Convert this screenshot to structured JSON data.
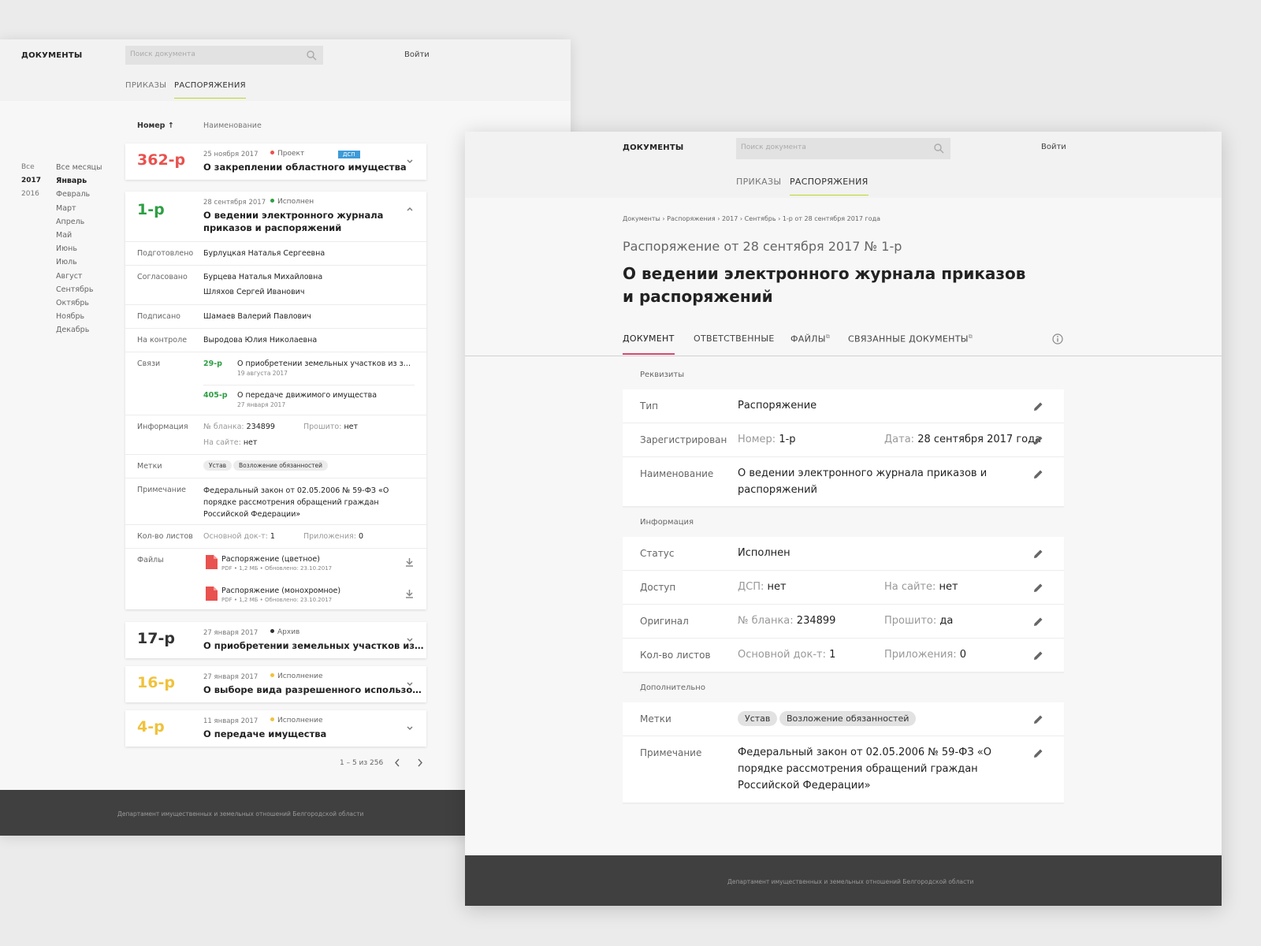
{
  "common": {
    "logo": "ДОКУМЕНТЫ",
    "search_placeholder": "Поиск документа",
    "login": "Войти",
    "nav": [
      "ПРИКАЗЫ",
      "РАСПОРЯЖЕНИЯ"
    ],
    "footer": "Департамент имущественных и земельных отношений Белгородской области"
  },
  "list": {
    "years": [
      "Все",
      "2017",
      "2016"
    ],
    "months": [
      "Все месяцы",
      "Январь",
      "Февраль",
      "Март",
      "Апрель",
      "Май",
      "Июнь",
      "Июль",
      "Август",
      "Сентябрь",
      "Октябрь",
      "Ноябрь",
      "Декабрь"
    ],
    "col_number": "Номер",
    "col_name": "Наименование",
    "card1": {
      "num": "362-р",
      "date": "25 ноября 2017",
      "status": "Проект",
      "badge": "ДСП",
      "title": "О закреплении областного имущества"
    },
    "card2": {
      "num": "1-р",
      "date": "28 сентября 2017",
      "status": "Исполнен",
      "title": "О ведении электронного журнала приказов и распоряжений",
      "labels": {
        "prepared": "Подготовлено",
        "agreed": "Согласовано",
        "signed": "Подписано",
        "control": "На контроле",
        "links": "Связи",
        "info": "Информация",
        "tags": "Метки",
        "note": "Примечание",
        "sheets": "Кол-во листов",
        "files": "Файлы"
      },
      "prepared": "Бурлуцкая Наталья Сергеевна",
      "agreed1": "Бурцева Наталья Михайловна",
      "agreed2": "Шляхов Сергей Иванович",
      "signed": "Шамаев Валерий Павлович",
      "control": "Выродова Юлия Николаевна",
      "link1": {
        "num": "29-р",
        "title": "О приобретении земельных участков из з…",
        "date": "19 августа 2017"
      },
      "link2": {
        "num": "405-р",
        "title": "О передаче движимого имущества",
        "date": "27 января 2017"
      },
      "info_blank_label": "№ бланка:",
      "info_blank": "234899",
      "info_stitched_label": "Прошито:",
      "info_stitched": "нет",
      "info_site_label": "На сайте:",
      "info_site": "нет",
      "tag1": "Устав",
      "tag2": "Возложение обязанностей",
      "note": "Федеральный закон от 02.05.2006 № 59-ФЗ «О порядке рассмотрения обращений граждан Российской Федерации»",
      "sheets_main_label": "Основной док-т:",
      "sheets_main": "1",
      "sheets_app_label": "Приложения:",
      "sheets_app": "0",
      "file1": {
        "name": "Распоряжение (цветное)",
        "meta": "PDF • 1,2 МБ • Обновлено: 23.10.2017"
      },
      "file2": {
        "name": "Распоряжение (монохромное)",
        "meta": "PDF • 1,2 МБ • Обновлено: 23.10.2017"
      }
    },
    "card3": {
      "num": "17-р",
      "date": "27 января 2017",
      "status": "Архив",
      "title": "О приобретении земельных участков из…"
    },
    "card4": {
      "num": "16-р",
      "date": "27 января 2017",
      "status": "Исполнение",
      "title": "О выборе вида разрешенного использо…"
    },
    "card5": {
      "num": "4-р",
      "date": "11 января 2017",
      "status": "Исполнение",
      "title": "О передаче имущества"
    },
    "pager": "1 – 5 из 256"
  },
  "detail": {
    "breadcrumb": "Документы › Распоряжения › 2017 › Сентябрь › 1-р от 28 сентября 2017 года",
    "subtitle": "Распоряжение от 28 сентября 2017 № 1-р",
    "title": "О ведении электронного журнала приказов и распоряжений",
    "tabs": [
      "ДОКУМЕНТ",
      "ОТВЕТСТВЕННЫЕ",
      "ФАЙЛЫ",
      "СВЯЗАННЫЕ ДОКУМЕНТЫ"
    ],
    "sec_requisites": "Реквизиты",
    "sec_info": "Информация",
    "sec_extra": "Дополнительно",
    "type_label": "Тип",
    "type": "Распоряжение",
    "reg_label": "Зарегистрирован",
    "reg_num_label": "Номер:",
    "reg_num": "1-р",
    "reg_date_label": "Дата:",
    "reg_date": "28 сентября 2017 года",
    "name_label": "Наименование",
    "name": "О ведении электронного журнала приказов и распоряжений",
    "status_label": "Статус",
    "status": "Исполнен",
    "access_label": "Доступ",
    "dsp_label": "ДСП:",
    "dsp": "нет",
    "site_label": "На сайте:",
    "site": "нет",
    "orig_label": "Оригинал",
    "blank_label": "№ бланка:",
    "blank": "234899",
    "stitched_label": "Прошито:",
    "stitched": "да",
    "sheets_label": "Кол-во листов",
    "main_label": "Основной док-т:",
    "main": "1",
    "app_label": "Приложения:",
    "app": "0",
    "tags_label": "Метки",
    "tag1": "Устав",
    "tag2": "Возложение обязанностей",
    "note_label": "Примечание",
    "note": "Федеральный закон от 02.05.2006 № 59-ФЗ «О порядке рассмотрения обращений граждан Российской Федерации»"
  },
  "colors": {
    "accent_green": "#b7d92c",
    "tab_pink": "#d9466d",
    "red": "#e8524f",
    "green": "#2e9e44",
    "yellow": "#f0c23c",
    "blue_badge": "#3d9bd8"
  }
}
